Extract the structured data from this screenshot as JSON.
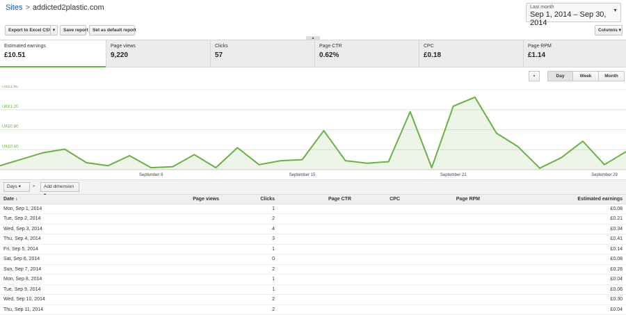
{
  "breadcrumb": {
    "sites_link": "Sites",
    "separator": ">",
    "site": "addicted2plastic.com"
  },
  "daterange": {
    "preset": "Last month",
    "range": "Sep 1, 2014 – Sep 30, 2014"
  },
  "toolbar": {
    "export_label": "Export to Excel CSV",
    "save_label": "Save report",
    "default_label": "Set as default report",
    "columns_label": "Columns"
  },
  "scorecards": [
    {
      "label": "Estimated earnings",
      "value": "£10.51"
    },
    {
      "label": "Page views",
      "value": "9,220"
    },
    {
      "label": "Clicks",
      "value": "57"
    },
    {
      "label": "Page CTR",
      "value": "0.62%"
    },
    {
      "label": "CPC",
      "value": "£0.18"
    },
    {
      "label": "Page RPM",
      "value": "£1.14"
    }
  ],
  "graph_tools": {
    "day": "Day",
    "week": "Week",
    "month": "Month"
  },
  "chart_data": {
    "type": "area",
    "series": [
      {
        "name": "Estimated earnings",
        "values": [
          0.08,
          0.21,
          0.34,
          0.41,
          0.14,
          0.08,
          0.28,
          0.04,
          0.06,
          0.3,
          0.04,
          0.44,
          0.1,
          0.18,
          0.2,
          0.78,
          0.18,
          0.13,
          0.16,
          1.16,
          0.04,
          1.27,
          1.45,
          0.73,
          0.46,
          0.03,
          0.24,
          0.57,
          0.1,
          0.36
        ]
      }
    ],
    "ylim": [
      0,
      1.6
    ],
    "yticks": [
      "UK£0.40",
      "UK£0.80",
      "UK£1.20",
      "UK£1.60"
    ],
    "xticks": [
      "September 8",
      "September 15",
      "September 22",
      "September 29"
    ],
    "color": "#6ab042"
  },
  "tablebar": {
    "days_label": "Days",
    "chevron": "»",
    "add_dimension_label": "Add dimension"
  },
  "table": {
    "headers": [
      "Date",
      "Page views",
      "Clicks",
      "Page CTR",
      "CPC",
      "Page RPM",
      "Estimated earnings"
    ],
    "sort_glyph": "↓",
    "rows": [
      [
        "Mon, Sep 1, 2014",
        "",
        "1",
        "",
        "",
        "",
        "£0.08"
      ],
      [
        "Tue, Sep 2, 2014",
        "",
        "2",
        "",
        "",
        "",
        "£0.21"
      ],
      [
        "Wed, Sep 3, 2014",
        "",
        "4",
        "",
        "",
        "",
        "£0.34"
      ],
      [
        "Thu, Sep 4, 2014",
        "",
        "3",
        "",
        "",
        "",
        "£0.41"
      ],
      [
        "Fri, Sep 5, 2014",
        "",
        "1",
        "",
        "",
        "",
        "£0.14"
      ],
      [
        "Sat, Sep 6, 2014",
        "",
        "0",
        "",
        "",
        "",
        "£0.08"
      ],
      [
        "Sun, Sep 7, 2014",
        "",
        "2",
        "",
        "",
        "",
        "£0.28"
      ],
      [
        "Mon, Sep 8, 2014",
        "",
        "1",
        "",
        "",
        "",
        "£0.04"
      ],
      [
        "Tue, Sep 9, 2014",
        "",
        "1",
        "",
        "",
        "",
        "£0.06"
      ],
      [
        "Wed, Sep 10, 2014",
        "",
        "2",
        "",
        "",
        "",
        "£0.30"
      ],
      [
        "Thu, Sep 11, 2014",
        "",
        "2",
        "",
        "",
        "",
        "£0.04"
      ]
    ]
  }
}
